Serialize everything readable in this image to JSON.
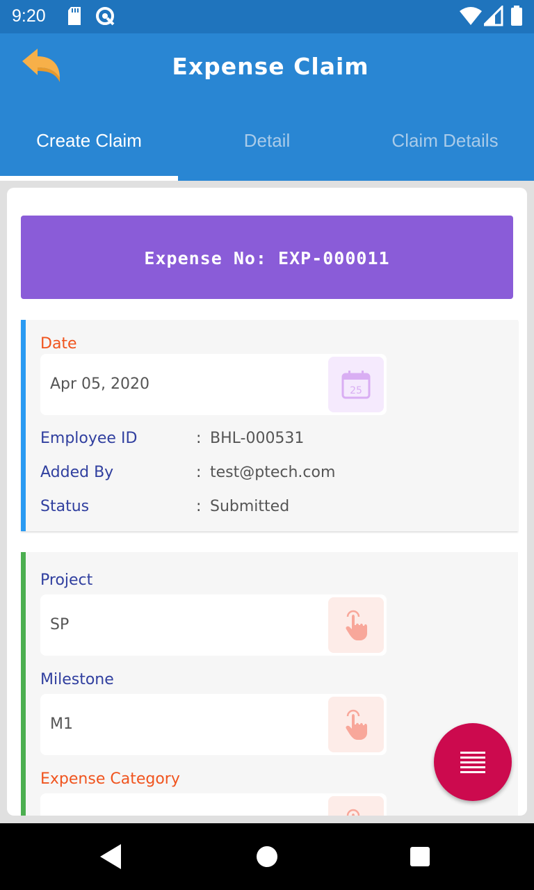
{
  "status_bar": {
    "time": "9:20",
    "icons": [
      "sd-card-icon",
      "vpn-icon",
      "wifi-icon",
      "signal-icon",
      "battery-icon"
    ]
  },
  "app_bar": {
    "title": "Expense Claim",
    "back_icon": "back-arrow-icon"
  },
  "tabs": [
    {
      "label": "Create Claim",
      "active": true
    },
    {
      "label": "Detail",
      "active": false
    },
    {
      "label": "Claim Details",
      "active": false
    }
  ],
  "expense": {
    "number_text": "Expense No: EXP-000011"
  },
  "date_section": {
    "label": "Date",
    "value": "Apr 05, 2020",
    "icon": "calendar-icon",
    "calendar_day": "25"
  },
  "info": {
    "employee_id": {
      "label": "Employee ID",
      "value": "BHL-000531"
    },
    "added_by": {
      "label": "Added By",
      "value": "test@ptech.com"
    },
    "status": {
      "label": "Status",
      "value": "Submitted"
    },
    "colon": ":"
  },
  "project": {
    "label": "Project",
    "value": "SP",
    "icon": "touch-icon"
  },
  "milestone": {
    "label": "Milestone",
    "value": "M1",
    "icon": "touch-icon"
  },
  "expense_category": {
    "label": "Expense Category",
    "value": "",
    "icon": "touch-icon"
  },
  "fab": {
    "icon": "menu-icon"
  },
  "nav": {
    "icons": [
      "nav-back-icon",
      "nav-home-icon",
      "nav-recents-icon"
    ]
  },
  "colors": {
    "status_bar": "#1f74bd",
    "app_bar": "#2986d3",
    "banner": "#8a5cd8",
    "label_orange": "#f0541e",
    "label_blue": "#303f9f",
    "card1_accent": "#2a9af2",
    "card2_accent": "#4caf50",
    "fab": "#cc0a4e"
  }
}
